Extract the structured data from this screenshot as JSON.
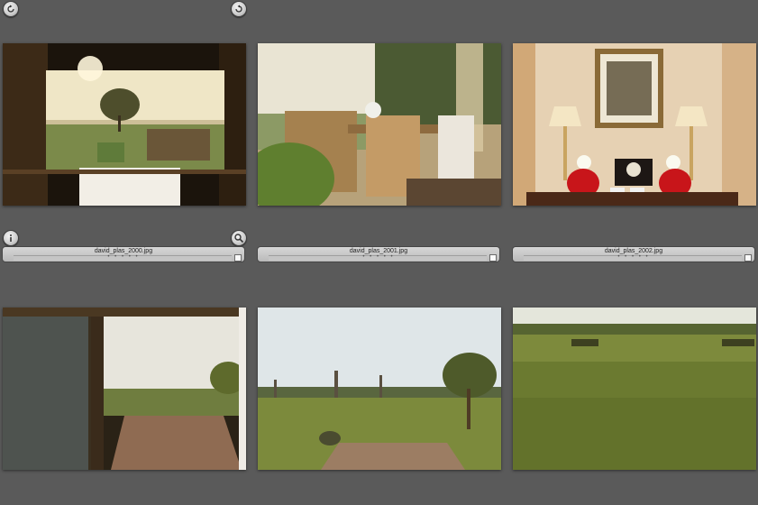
{
  "browser": {
    "toolbar": {
      "left_icon": "rotate-left-icon",
      "right_icon": "rotate-right-icon"
    },
    "selected": {
      "info_icon": "info-icon",
      "zoom_icon": "zoom-icon"
    },
    "thumbnails": [
      {
        "filename": "david_plas_2000.jpg",
        "rating": "• • • • •"
      },
      {
        "filename": "david_plas_2001.jpg",
        "rating": "• • • • •"
      },
      {
        "filename": "david_plas_2002.jpg",
        "rating": "• • • • •"
      },
      {
        "filename": "",
        "rating": ""
      },
      {
        "filename": "",
        "rating": ""
      },
      {
        "filename": "",
        "rating": ""
      }
    ]
  }
}
